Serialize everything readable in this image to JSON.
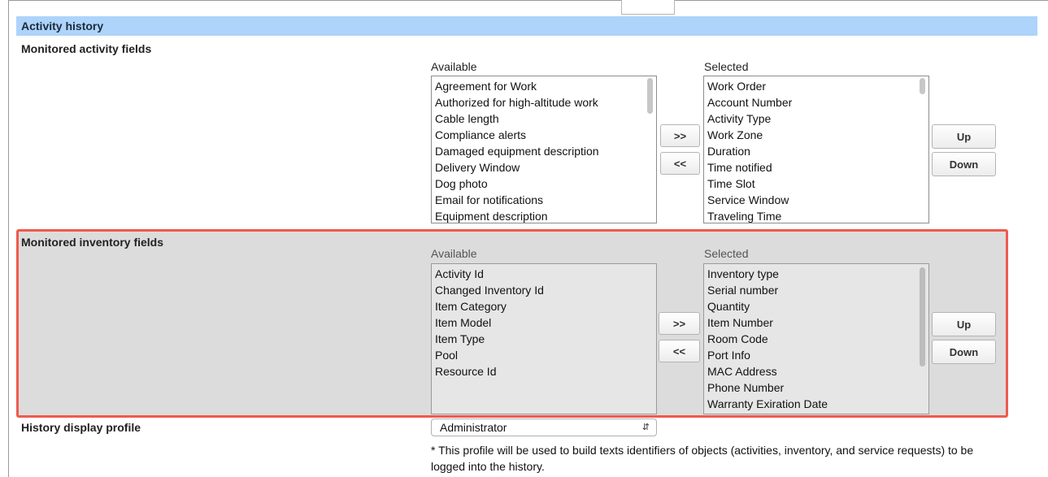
{
  "section": {
    "title": "Activity history"
  },
  "activity": {
    "label": "Monitored activity fields",
    "available_label": "Available",
    "selected_label": "Selected",
    "available": [
      "Agreement for Work",
      "Authorized for high-altitude work",
      "Cable length",
      "Compliance alerts",
      "Damaged equipment description",
      "Delivery Window",
      "Dog photo",
      "Email for notifications",
      "Equipment description"
    ],
    "selected": [
      "Work Order",
      "Account Number",
      "Activity Type",
      "Work Zone",
      "Duration",
      "Time notified",
      "Time Slot",
      "Service Window",
      "Traveling Time"
    ],
    "add_label": ">>",
    "remove_label": "<<",
    "up_label": "Up",
    "down_label": "Down"
  },
  "inventory": {
    "label": "Monitored inventory fields",
    "available_label": "Available",
    "selected_label": "Selected",
    "available": [
      "Activity Id",
      "Changed Inventory Id",
      "Item Category",
      "Item Model",
      "Item Type",
      "Pool",
      "Resource Id"
    ],
    "selected": [
      "Inventory type",
      "Serial number",
      "Quantity",
      "Item Number",
      "Room Code",
      "Port Info",
      "MAC Address",
      "Phone Number",
      "Warranty Exiration Date"
    ],
    "add_label": ">>",
    "remove_label": "<<",
    "up_label": "Up",
    "down_label": "Down"
  },
  "history_profile": {
    "label": "History display profile",
    "value": "Administrator",
    "note": "* This profile will be used to build texts identifiers of objects (activities, inventory, and service requests) to be logged into the history."
  }
}
